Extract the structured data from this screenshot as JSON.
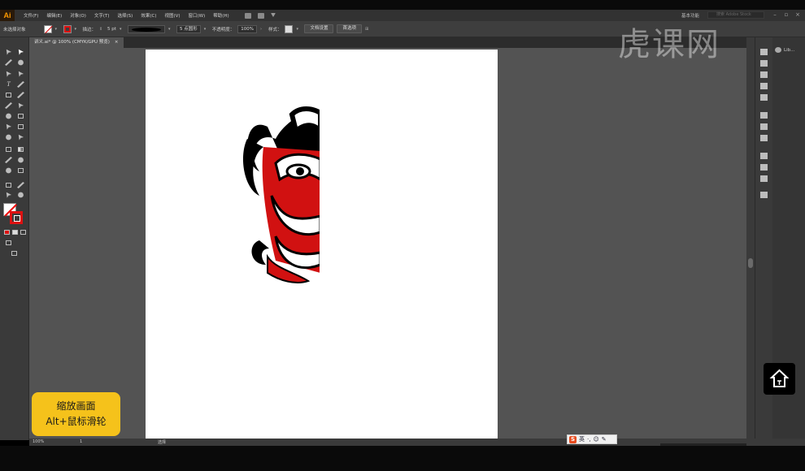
{
  "app": {
    "logo": "Ai",
    "workspace": "基本功能",
    "search_placeholder": "搜索 Adobe Stock"
  },
  "menu": [
    {
      "label": "文件(F)"
    },
    {
      "label": "编辑(E)"
    },
    {
      "label": "对象(O)"
    },
    {
      "label": "文字(T)"
    },
    {
      "label": "选择(S)"
    },
    {
      "label": "效果(C)"
    },
    {
      "label": "视图(V)"
    },
    {
      "label": "窗口(W)"
    },
    {
      "label": "帮助(H)"
    }
  ],
  "controlbar": {
    "selection_label": "未选择对象",
    "stroke_label": "描边：",
    "stroke_value": "5 pt",
    "brush_size": "5 点圆形",
    "opacity_label": "不透明度：",
    "opacity_value": "100%",
    "style_label": "样式：",
    "doc_setup": "文档设置",
    "prefs": "首选项"
  },
  "document": {
    "tab_title": "讲义.ai* @ 100% (CMYK/GPU 预览)",
    "close": "×"
  },
  "status": {
    "zoom": "100%",
    "artboard": "1",
    "tool": "选择"
  },
  "ime": {
    "logo": "S",
    "lang": "英"
  },
  "watermark": "虎课网",
  "hint": {
    "line1": "缩放画面",
    "line2": "Alt+鼠标滑轮"
  },
  "right_panel": {
    "libraries": "Lib..."
  },
  "colors": {
    "accent_red": "#d11111",
    "hint_bg": "#f5c21b",
    "ai_orange": "#ff9a00"
  },
  "icons": [
    "selection-icon",
    "direct-selection-icon",
    "magic-wand-icon",
    "lasso-icon",
    "pen-icon",
    "curvature-icon",
    "type-icon",
    "line-icon",
    "rectangle-icon",
    "paintbrush-icon",
    "pencil-icon",
    "scissors-icon",
    "rotate-icon",
    "scale-icon",
    "width-icon",
    "free-transform-icon",
    "shape-builder-icon",
    "perspective-icon",
    "mesh-icon",
    "gradient-icon",
    "eyedropper-icon",
    "blend-icon",
    "symbol-sprayer-icon",
    "graph-icon",
    "artboard-icon",
    "slice-icon",
    "hand-icon",
    "zoom-icon"
  ]
}
